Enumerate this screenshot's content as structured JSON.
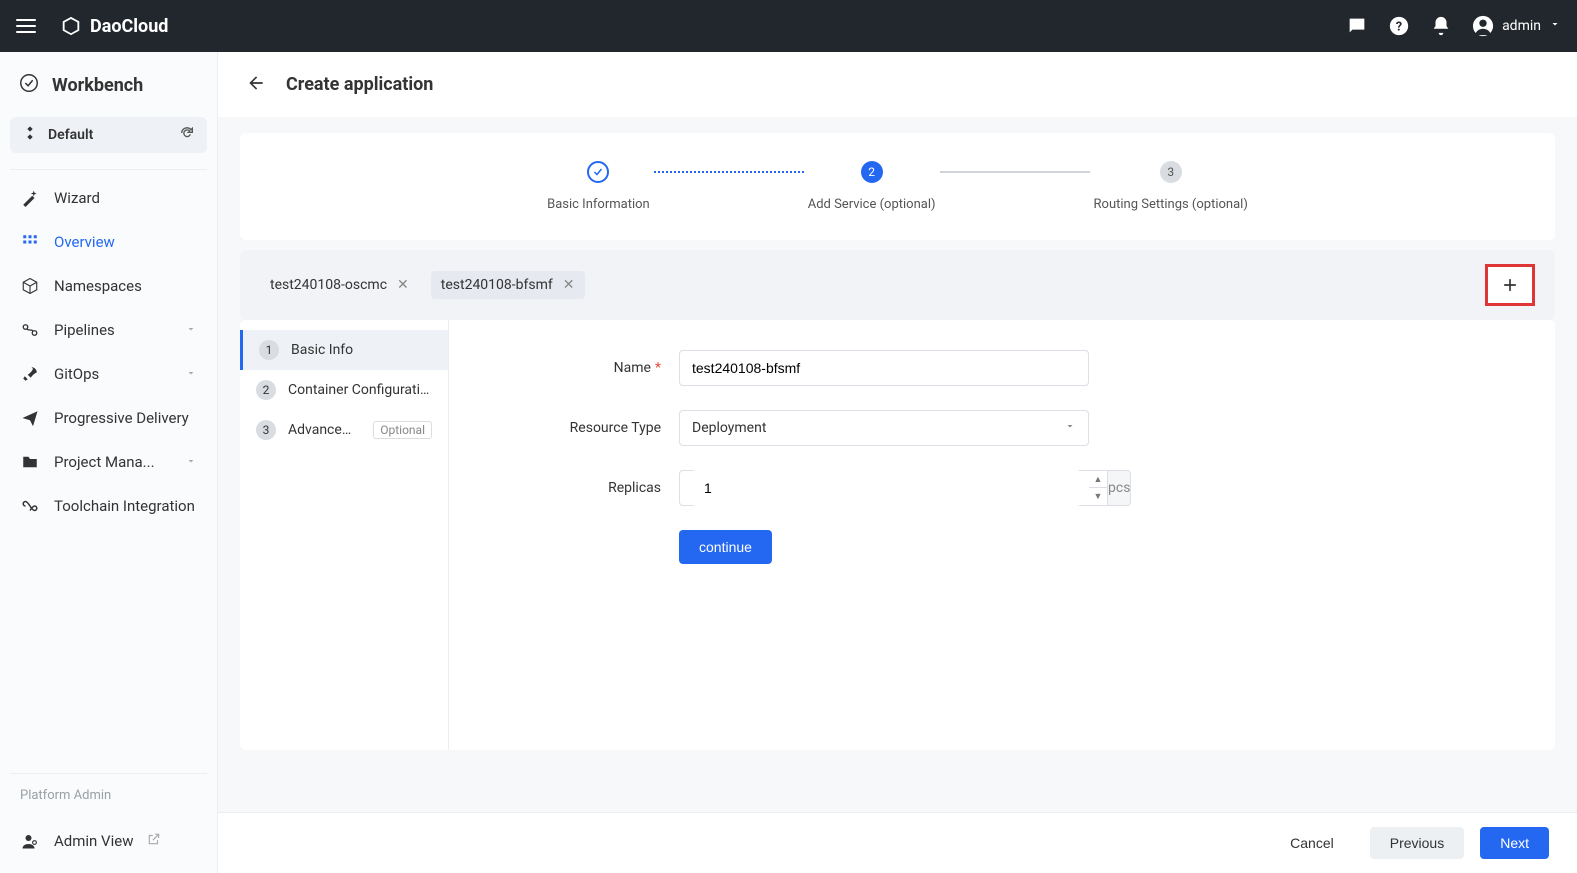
{
  "brand": "DaoCloud",
  "user": {
    "name": "admin"
  },
  "sidebar": {
    "title": "Workbench",
    "context": {
      "label": "Default"
    },
    "items": [
      {
        "label": "Wizard",
        "icon": "wand"
      },
      {
        "label": "Overview",
        "icon": "grid",
        "active": true
      },
      {
        "label": "Namespaces",
        "icon": "cube"
      },
      {
        "label": "Pipelines",
        "icon": "link",
        "expandable": true
      },
      {
        "label": "GitOps",
        "icon": "rocket",
        "expandable": true
      },
      {
        "label": "Progressive Delivery",
        "icon": "send"
      },
      {
        "label": "Project Mana...",
        "icon": "folder",
        "expandable": true
      },
      {
        "label": "Toolchain Integration",
        "icon": "infinity"
      }
    ],
    "platformAdminLabel": "Platform Admin",
    "adminView": "Admin View"
  },
  "page": {
    "title": "Create application"
  },
  "wizard_steps": [
    {
      "label": "Basic Information",
      "state": "done",
      "num": "✓"
    },
    {
      "label": "Add Service (optional)",
      "state": "active",
      "num": "2"
    },
    {
      "label": "Routing Settings (optional)",
      "state": "wait",
      "num": "3"
    }
  ],
  "tabs": [
    {
      "label": "test240108-oscmc",
      "active": false
    },
    {
      "label": "test240108-bfsmf",
      "active": true
    }
  ],
  "side_steps": [
    {
      "num": "1",
      "label": "Basic Info",
      "active": true
    },
    {
      "num": "2",
      "label": "Container Configuration",
      "active": false
    },
    {
      "num": "3",
      "label": "Advanced ...",
      "active": false,
      "tag": "Optional"
    }
  ],
  "form": {
    "name_label": "Name",
    "name_value": "test240108-bfsmf",
    "resource_type_label": "Resource Type",
    "resource_type_value": "Deployment",
    "replicas_label": "Replicas",
    "replicas_value": "1",
    "replicas_unit": "pcs",
    "continue_label": "continue"
  },
  "footer": {
    "cancel": "Cancel",
    "previous": "Previous",
    "next": "Next"
  }
}
